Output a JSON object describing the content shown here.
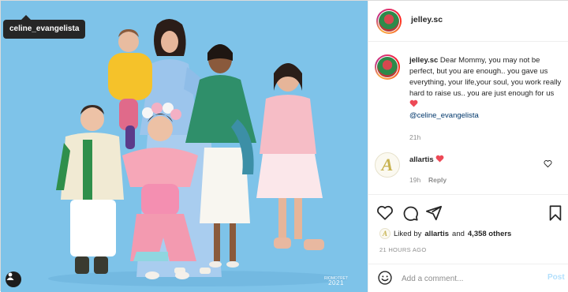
{
  "photo": {
    "tag_label": "celine_evangelista",
    "watermark_line": "RIOMOTRET",
    "watermark_year": "2021",
    "background_color": "#7ec3e9"
  },
  "post": {
    "author": "jelley.sc",
    "caption_user": "jelley.sc",
    "caption_text": "Dear Mommy, you may not be perfect, but you are enough.. you gave us everything, your life,your soul, you work really hard to raise us.. you are just enough for us",
    "caption_mention": "@celine_evangelista",
    "caption_time": "21h"
  },
  "comment": {
    "user": "allartis",
    "time": "19h",
    "reply_label": "Reply"
  },
  "likes": {
    "prefix": "Liked by",
    "user": "allartis",
    "and": "and",
    "count": "4,358 others",
    "time_ago": "21 HOURS AGO"
  },
  "composer": {
    "placeholder": "Add a comment...",
    "post_label": "Post"
  },
  "icons": {
    "like": "heart-icon",
    "comment": "comment-icon",
    "share": "paper-plane-icon",
    "save": "bookmark-icon",
    "emoji": "smiley-icon",
    "user_tags": "person-icon"
  },
  "colors": {
    "heart_red": "#ed4956",
    "link_blue": "#00376b",
    "post_button_disabled": "#b2dffc"
  }
}
